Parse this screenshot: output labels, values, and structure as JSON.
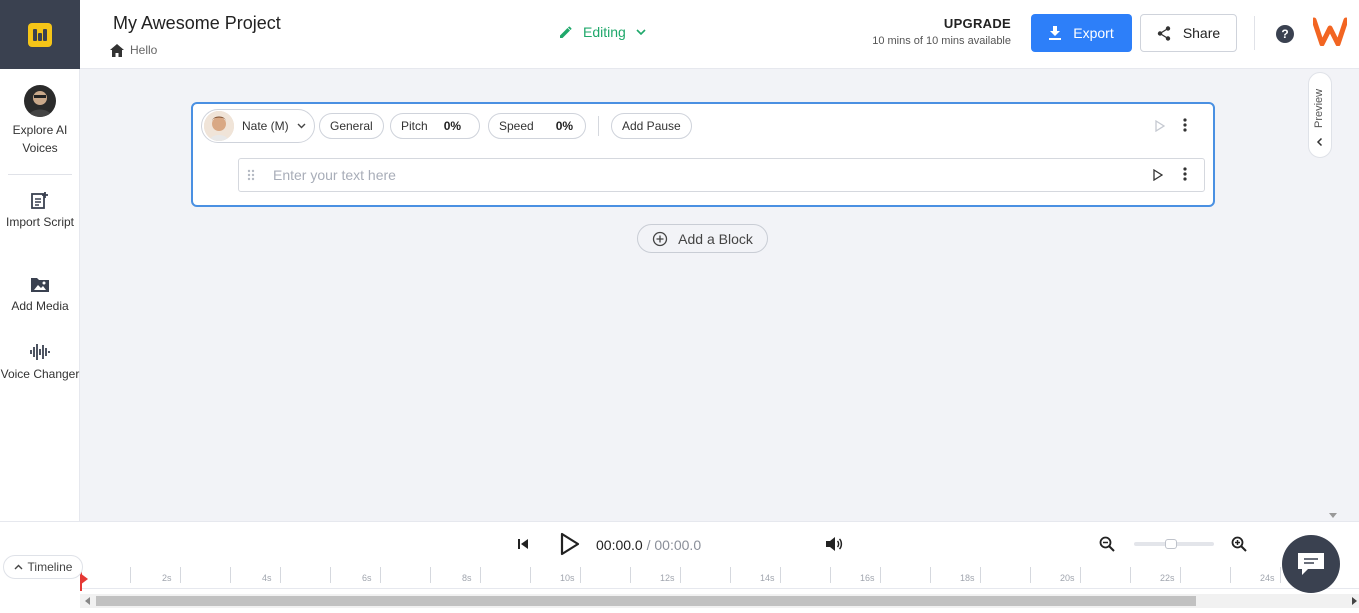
{
  "header": {
    "project_title": "My Awesome Project",
    "breadcrumb": "Hello",
    "mode_label": "Editing",
    "upgrade_label": "UPGRADE",
    "usage_text": "10 mins of 10 mins available",
    "export_label": "Export",
    "share_label": "Share",
    "help_label": "?"
  },
  "sidebar": {
    "items": [
      {
        "label": "Explore AI Voices",
        "icon": "voice-avatar"
      },
      {
        "label": "Import Script",
        "icon": "import-script-icon"
      },
      {
        "label": "Add Media",
        "icon": "media-folder-icon"
      },
      {
        "label": "Voice Changer",
        "icon": "waveform-icon"
      }
    ]
  },
  "block": {
    "voice": "Nate (M)",
    "style": "General",
    "pitch_label": "Pitch",
    "pitch_value": "0%",
    "speed_label": "Speed",
    "speed_value": "0%",
    "add_pause_label": "Add Pause",
    "text_placeholder": "Enter your text here",
    "text_value": ""
  },
  "add_block_label": "Add a Block",
  "preview_label": "Preview",
  "player": {
    "current_time": "00:00.0",
    "separator": " / ",
    "total_time": "00:00.0",
    "zoom_level": 0.45
  },
  "timeline": {
    "tab_label": "Timeline",
    "ticks": [
      "2s",
      "4s",
      "6s",
      "8s",
      "10s",
      "12s",
      "14s",
      "16s",
      "18s",
      "20s",
      "22s",
      "24s"
    ]
  },
  "colors": {
    "accent": "#2d7ff9",
    "editing": "#1fa86b",
    "logo_bg": "#3a4150",
    "logo_yellow": "#f5c518",
    "brand_orange": "#f26522",
    "playhead": "#e53935"
  }
}
